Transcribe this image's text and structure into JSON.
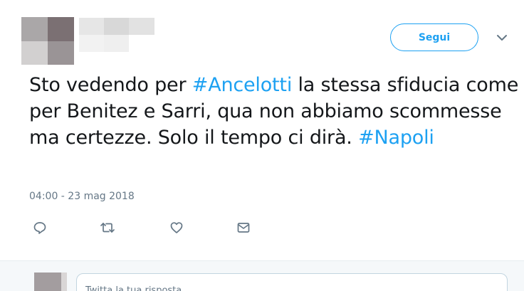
{
  "tweet": {
    "follow_label": "Segui",
    "text_parts": [
      "Sto vedendo per ",
      "#Ancelotti",
      " la stessa sfiducia come per Benitez e Sarri, qua non abbiamo scommesse ma certezze. Solo il tempo ci dirà. ",
      "#Napoli"
    ],
    "hashtags": [
      "#Ancelotti",
      "#Napoli"
    ],
    "timestamp": "04:00 - 23 mag 2018",
    "actions": [
      {
        "name": "reply",
        "icon": "reply-icon"
      },
      {
        "name": "retweet",
        "icon": "retweet-icon"
      },
      {
        "name": "like",
        "icon": "heart-icon"
      },
      {
        "name": "direct-message",
        "icon": "envelope-icon"
      }
    ]
  },
  "reply": {
    "placeholder": "Twitta la tua risposta"
  },
  "colors": {
    "accent": "#1da1f2",
    "text": "#14171a",
    "muted": "#657786",
    "divider": "#e6ecf0"
  }
}
